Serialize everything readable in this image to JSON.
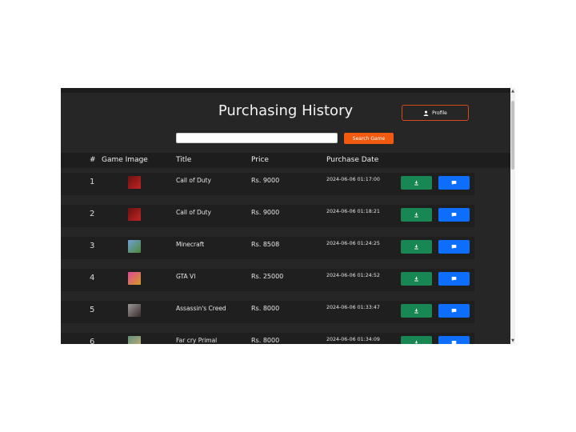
{
  "header": {
    "title": "Purchasing History",
    "profile_label": "Profile"
  },
  "search": {
    "value": "",
    "button_label": "Search Game"
  },
  "table": {
    "columns": [
      "#",
      "Game Image",
      "Title",
      "Price",
      "Purchase Date"
    ],
    "rows": [
      {
        "num": "1",
        "title": "Call of Duty",
        "price": "Rs. 9000",
        "date": "2024-06-06 01:17:00",
        "thumb": [
          "#6a1111",
          "#c22424"
        ]
      },
      {
        "num": "2",
        "title": "Call of Duty",
        "price": "Rs. 9000",
        "date": "2024-06-06 01:18:21",
        "thumb": [
          "#6a1111",
          "#c22424"
        ]
      },
      {
        "num": "3",
        "title": "Minecraft",
        "price": "Rs. 8508",
        "date": "2024-06-06 01:24:25",
        "thumb": [
          "#6fa0d8",
          "#4d8a34"
        ]
      },
      {
        "num": "4",
        "title": "GTA VI",
        "price": "Rs. 25000",
        "date": "2024-06-06 01:24:52",
        "thumb": [
          "#e0499a",
          "#d39a21"
        ]
      },
      {
        "num": "5",
        "title": "Assassin's Creed",
        "price": "Rs. 8000",
        "date": "2024-06-06 01:33:47",
        "thumb": [
          "#9c9a9a",
          "#3a2a2a"
        ]
      },
      {
        "num": "6",
        "title": "Far cry Primal",
        "price": "Rs. 8000",
        "date": "2024-06-06 01:34:09",
        "thumb": [
          "#5e8f7a",
          "#c9b07a"
        ]
      }
    ]
  },
  "colors": {
    "background": "#262626",
    "accent": "#f25a10",
    "download": "#198754",
    "message": "#0d6efd"
  },
  "icons": {
    "profile": "user-icon",
    "download": "download-icon",
    "message": "message-icon"
  }
}
